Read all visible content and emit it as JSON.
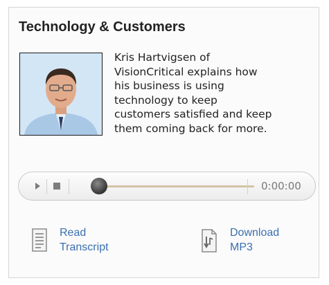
{
  "widget": {
    "title": "Technology & Customers",
    "photo_icon": "person-photo",
    "description_lines": [
      "Kris Hartvigsen of",
      "VisionCritical explains how",
      "his business is using",
      "technology to keep",
      "customers satisfied and keep",
      "them coming back for more."
    ]
  },
  "player": {
    "play_icon": "play-icon",
    "stop_icon": "stop-icon",
    "progress": 0,
    "time": "0:00:00"
  },
  "links": {
    "transcript": {
      "icon": "document-icon",
      "line1": "Read",
      "line2": "Transcript"
    },
    "download": {
      "icon": "download-icon",
      "line1": "Download",
      "line2": "MP3"
    }
  },
  "colors": {
    "link": "#3a6fb0",
    "track": "#d4c3a4",
    "border": "#d6d6d6"
  }
}
